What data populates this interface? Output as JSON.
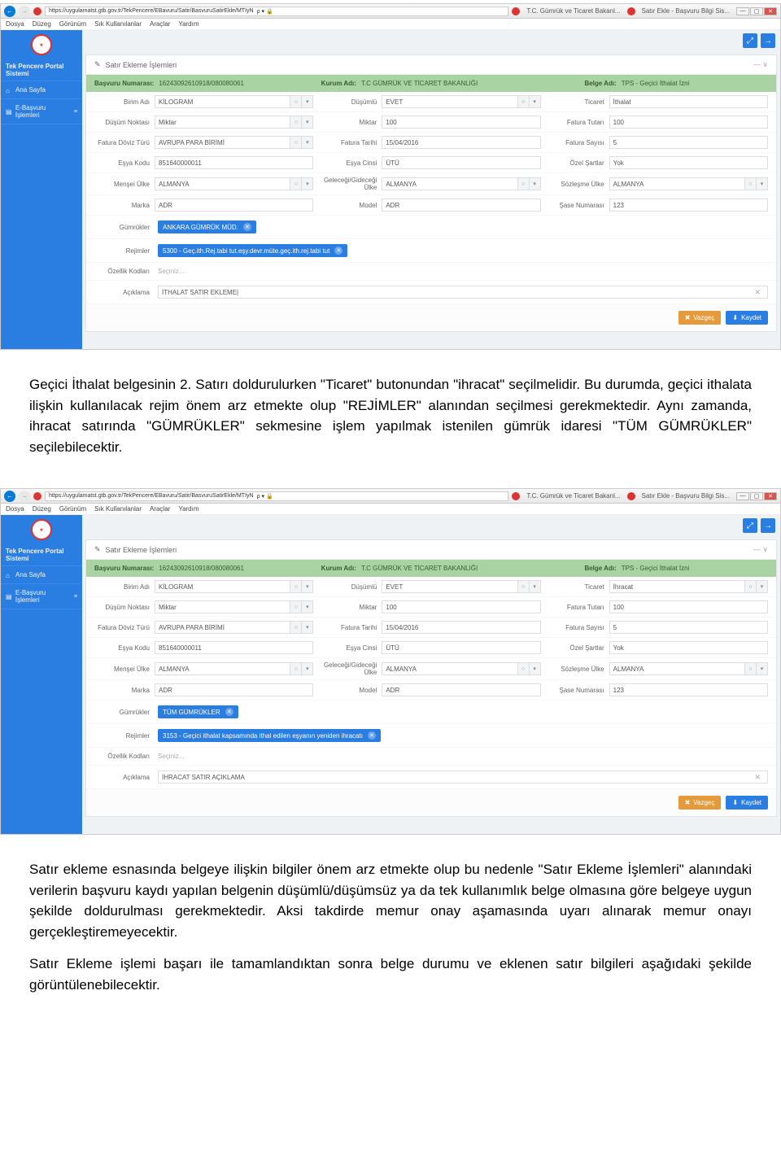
{
  "browser": {
    "url": "https://uygulamatst.gtb.gov.tr/TekPencere/EBavuru/Satir/BasvuruSatirEkle/MTIyN",
    "lock": "🔒",
    "tab1": "T.C. Gümrük ve Ticaret Bakanl...",
    "tab2": "Satır Ekle - Başvuru Bilgi Sis...",
    "menu": [
      "Dosya",
      "Düzeg",
      "Görünüm",
      "Sık Kullanılanlar",
      "Araçlar",
      "Yardım"
    ]
  },
  "sidebar": {
    "brand": "Tek Pencere Portal Sistemi",
    "home": "Ana Sayfa",
    "ebasvuru": "E-Başvuru İşlemleri"
  },
  "panel": {
    "title": "Satır Ekleme İşlemleri",
    "pencil": "✎"
  },
  "info": {
    "basvuru_lbl": "Başvuru Numarası:",
    "basvuru_val": "16243092610918/080080061",
    "kurum_lbl": "Kurum Adı:",
    "kurum_val": "T.C GÜMRÜK VE TİCARET BAKANLIĞI",
    "belge_lbl": "Belge Adı:",
    "belge_val": "TPS - Geçici İthalat İzni"
  },
  "form": {
    "birim_lbl": "Birim Adı",
    "birim": "KİLOGRAM",
    "dusumlu_lbl": "Düşümlü",
    "dusumlu": "EVET",
    "ticaret_lbl": "Ticaret",
    "dusum_nk_lbl": "Düşüm Noktası",
    "dusum_nk": "Miktar",
    "miktar_lbl": "Miktar",
    "miktar": "100",
    "fatura_tutari_lbl": "Fatura Tutarı",
    "fatura_tutari": "100",
    "fatura_doviz_lbl": "Fatura Döviz Türü",
    "fatura_doviz": "AVRUPA PARA BİRİMİ",
    "fatura_tarih_lbl": "Fatura Tarihi",
    "fatura_tarih": "15/04/2016",
    "fatura_sayi_lbl": "Fatura Sayısı",
    "fatura_sayi": "5",
    "esya_kodu_lbl": "Eşya Kodu",
    "esya_kodu": "851640000011",
    "esya_cinsi_lbl": "Eşya Cinsi",
    "esya_cinsi": "ÜTÜ",
    "ozel_sart_lbl": "Özel Şartlar",
    "ozel_sart": "Yok",
    "mensei_lbl": "Menşei Ülke",
    "mensei": "ALMANYA",
    "gelgid_lbl": "Geleceği/Gideceği Ülke",
    "gelgid": "ALMANYA",
    "sozlesme_lbl": "Sözleşme Ülke",
    "sozlesme": "ALMANYA",
    "marka_lbl": "Marka",
    "marka": "ADR",
    "model_lbl": "Model",
    "model": "ADR",
    "sase_lbl": "Şase Numarası",
    "sase": "123",
    "gumruk_lbl": "Gümrükler",
    "rejim_lbl": "Rejimler",
    "ozellik_lbl": "Özellik Kodları",
    "ozellik_ph": "Seçiniz...",
    "aciklama_lbl": "Açıklama"
  },
  "s1": {
    "ticaret": "İthalat",
    "gumruk_tag": "ANKARA GÜMRÜK MÜD.",
    "rejim_tag": "5300 - Geç.ith.Rej.tabi tut.eşy.devr.müte.geç.ith.rej.tabi tut",
    "aciklama": "İTHALAT SATIR EKLEME|"
  },
  "s2": {
    "ticaret": "İhracat",
    "gumruk_tag": "TÜM GÜMRÜKLER",
    "rejim_tag": "3153 - Geçici ithalat kapsamında ithal edilen eşyanın yeniden ihracatı",
    "aciklama": "İHRACAT SATIR AÇIKLAMA"
  },
  "buttons": {
    "cancel": "Vazgeç",
    "save": "Kaydet"
  },
  "text": {
    "p1": "Geçici İthalat belgesinin 2. Satırı doldurulurken \"Ticaret\" butonundan \"ihracat\" seçilmelidir. Bu durumda, geçici ithalata ilişkin kullanılacak rejim önem arz etmekte olup \"REJİMLER\" alanından seçilmesi gerekmektedir. Aynı zamanda, ihracat satırında \"GÜMRÜKLER\" sekmesine işlem yapılmak istenilen gümrük idaresi \"TÜM GÜMRÜKLER\" seçilebilecektir.",
    "p2": "Satır ekleme esnasında belgeye ilişkin bilgiler önem arz etmekte olup bu nedenle \"Satır Ekleme İşlemleri\" alanındaki verilerin başvuru kaydı yapılan belgenin düşümlü/düşümsüz ya da tek kullanımlık belge olmasına göre belgeye uygun şekilde doldurulması gerekmektedir. Aksi takdirde memur onay aşamasında uyarı alınarak memur onayı gerçekleştiremeyecektir.",
    "p3": "Satır Ekleme işlemi başarı ile tamamlandıktan sonra belge durumu ve eklenen satır bilgileri aşağıdaki şekilde görüntülenebilecektir."
  }
}
